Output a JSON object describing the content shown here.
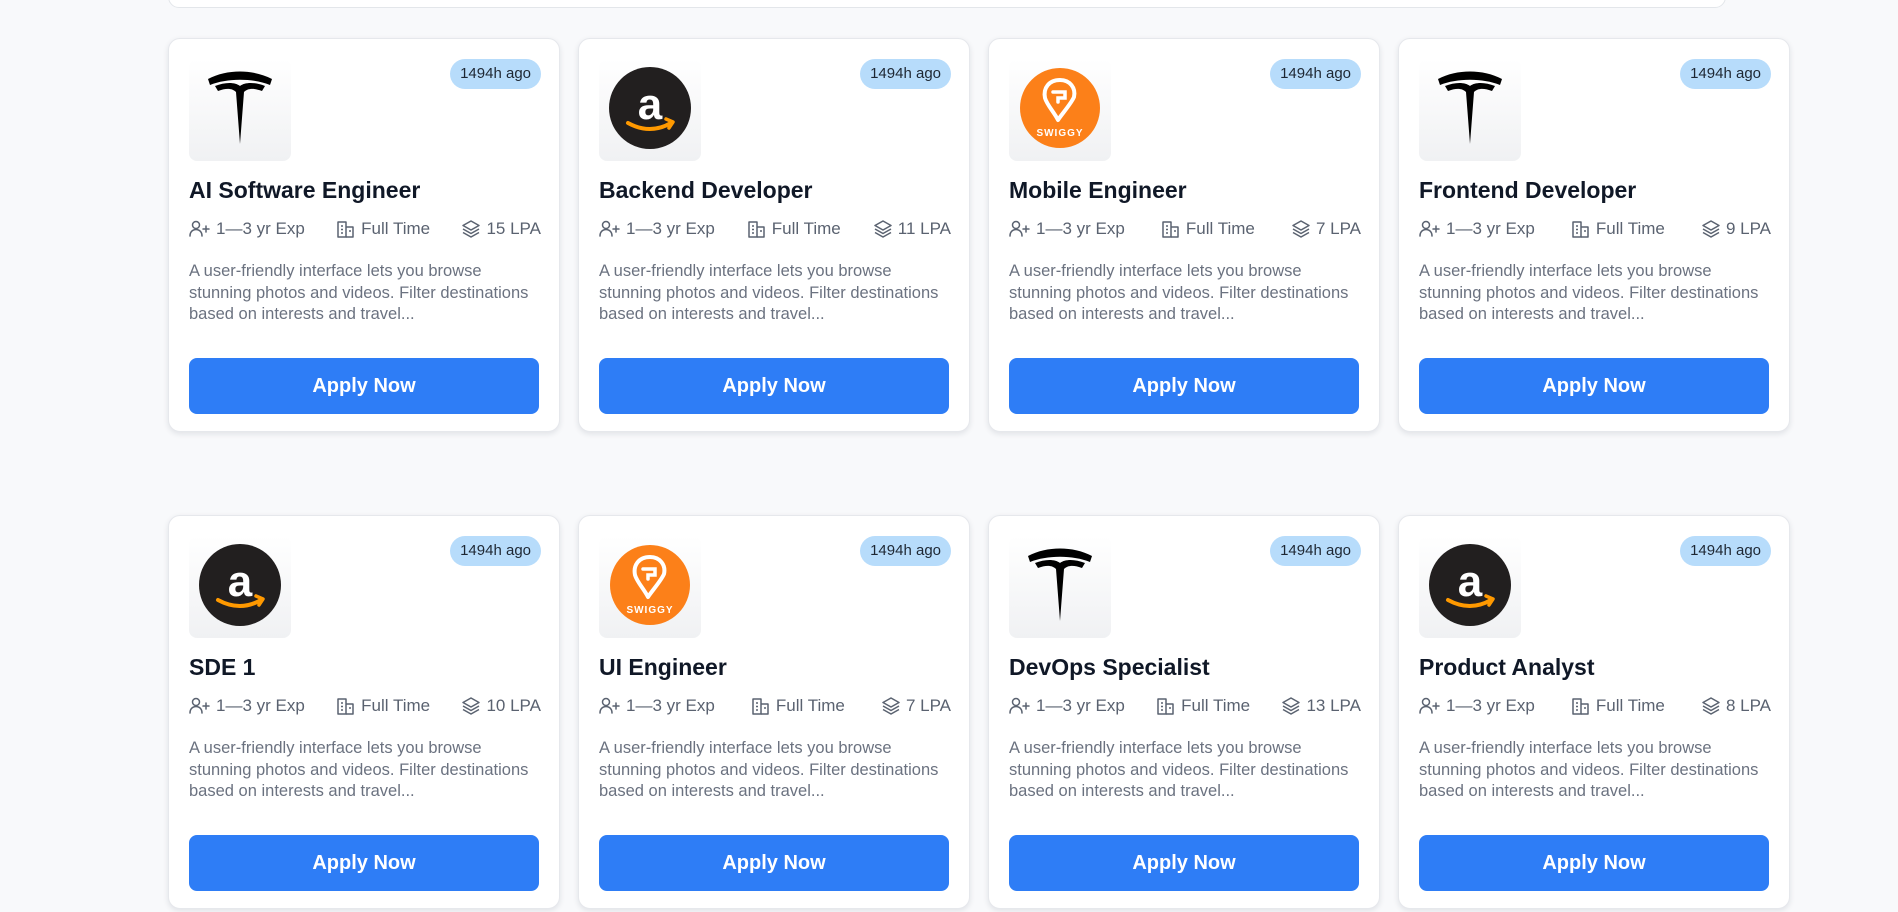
{
  "jobs": [
    {
      "company": "Tesla",
      "logo": "tesla-logo",
      "posted": "1494h ago",
      "title": "AI Software Engineer",
      "experience": "1—3 yr Exp",
      "job_type": "Full Time",
      "salary": "15 LPA",
      "description": "A user-friendly interface lets you browse stunning photos and videos. Filter destinations based on interests and travel...",
      "apply_label": "Apply Now"
    },
    {
      "company": "Amazon",
      "logo": "amazon-logo",
      "posted": "1494h ago",
      "title": "Backend Developer",
      "experience": "1—3 yr Exp",
      "job_type": "Full Time",
      "salary": "11 LPA",
      "description": "A user-friendly interface lets you browse stunning photos and videos. Filter destinations based on interests and travel...",
      "apply_label": "Apply Now"
    },
    {
      "company": "Swiggy",
      "logo": "swiggy-logo",
      "logo_text": "SWIGGY",
      "posted": "1494h ago",
      "title": "Mobile Engineer",
      "experience": "1—3 yr Exp",
      "job_type": "Full Time",
      "salary": "7 LPA",
      "description": "A user-friendly interface lets you browse stunning photos and videos. Filter destinations based on interests and travel...",
      "apply_label": "Apply Now"
    },
    {
      "company": "Tesla",
      "logo": "tesla-logo",
      "posted": "1494h ago",
      "title": "Frontend Developer",
      "experience": "1—3 yr Exp",
      "job_type": "Full Time",
      "salary": "9 LPA",
      "description": "A user-friendly interface lets you browse stunning photos and videos. Filter destinations based on interests and travel...",
      "apply_label": "Apply Now"
    },
    {
      "company": "Amazon",
      "logo": "amazon-logo",
      "posted": "1494h ago",
      "title": "SDE 1",
      "experience": "1—3 yr Exp",
      "job_type": "Full Time",
      "salary": "10 LPA",
      "description": "A user-friendly interface lets you browse stunning photos and videos. Filter destinations based on interests and travel...",
      "apply_label": "Apply Now"
    },
    {
      "company": "Swiggy",
      "logo": "swiggy-logo",
      "logo_text": "SWIGGY",
      "posted": "1494h ago",
      "title": "UI Engineer",
      "experience": "1—3 yr Exp",
      "job_type": "Full Time",
      "salary": "7 LPA",
      "description": "A user-friendly interface lets you browse stunning photos and videos. Filter destinations based on interests and travel...",
      "apply_label": "Apply Now"
    },
    {
      "company": "Tesla",
      "logo": "tesla-logo",
      "posted": "1494h ago",
      "title": "DevOps Specialist",
      "experience": "1—3 yr Exp",
      "job_type": "Full Time",
      "salary": "13 LPA",
      "description": "A user-friendly interface lets you browse stunning photos and videos. Filter destinations based on interests and travel...",
      "apply_label": "Apply Now"
    },
    {
      "company": "Amazon",
      "logo": "amazon-logo",
      "posted": "1494h ago",
      "title": "Product Analyst",
      "experience": "1—3 yr Exp",
      "job_type": "Full Time",
      "salary": "8 LPA",
      "description": "A user-friendly interface lets you browse stunning photos and videos. Filter destinations based on interests and travel...",
      "apply_label": "Apply Now"
    }
  ],
  "icons": {
    "experience": "user-plus-icon",
    "job_type": "building-icon",
    "salary": "layers-icon"
  },
  "colors": {
    "primary": "#2e7df6",
    "badge": "#b7dcfb",
    "swiggy": "#fc8019",
    "amazon_bg": "#221f1f",
    "amazon_smile": "#ff9900"
  }
}
